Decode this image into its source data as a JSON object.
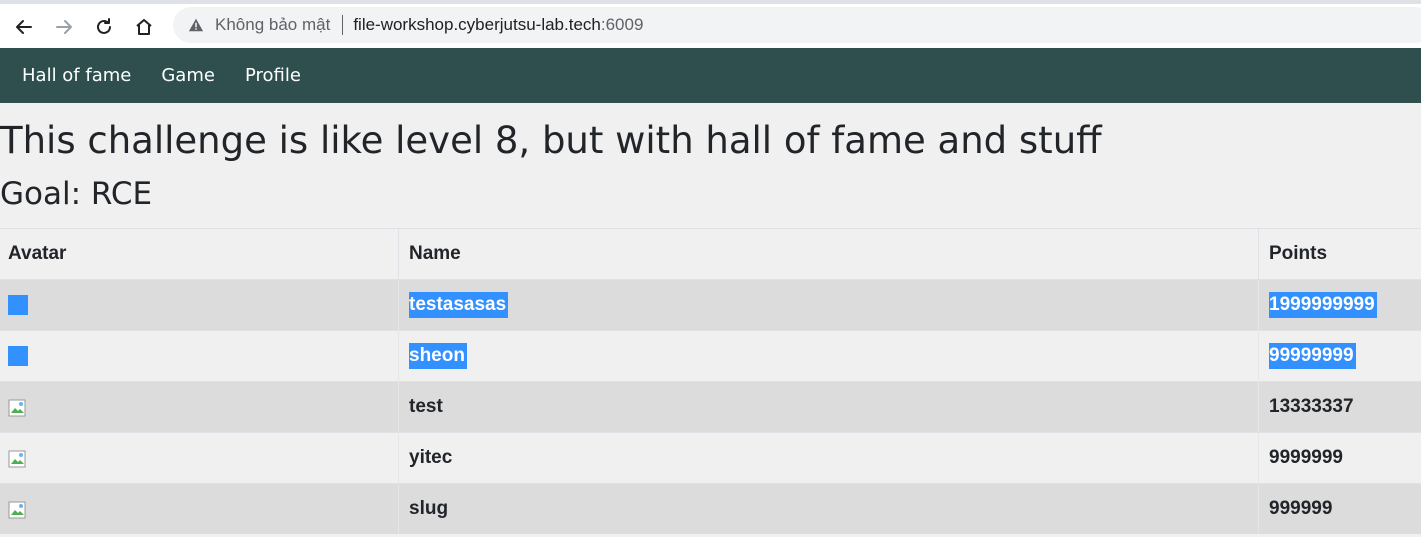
{
  "browser": {
    "security_label": "Không bảo mật",
    "url_host": "file-workshop.cyberjutsu-lab.tech",
    "url_port": ":6009"
  },
  "navbar": {
    "links": [
      {
        "label": "Hall of fame"
      },
      {
        "label": "Game"
      },
      {
        "label": "Profile"
      }
    ]
  },
  "page": {
    "subtitle": "This challenge is like level 8, but with hall of fame and stuff",
    "goal": "Goal: RCE"
  },
  "table": {
    "headers": [
      "Avatar",
      "Name",
      "Points"
    ],
    "rows": [
      {
        "name": "testasasas",
        "points": "1999999999",
        "selected": true
      },
      {
        "name": "sheon",
        "points": "99999999",
        "selected": true
      },
      {
        "name": "test",
        "points": "13333337",
        "selected": false
      },
      {
        "name": "yitec",
        "points": "9999999",
        "selected": false
      },
      {
        "name": "slug",
        "points": "999999",
        "selected": false
      }
    ]
  },
  "colors": {
    "navbar_bg": "#2f4f4f",
    "selection": "#3390ff",
    "row_alt": "#dcdcdc",
    "page_bg": "#f0f0f0"
  }
}
